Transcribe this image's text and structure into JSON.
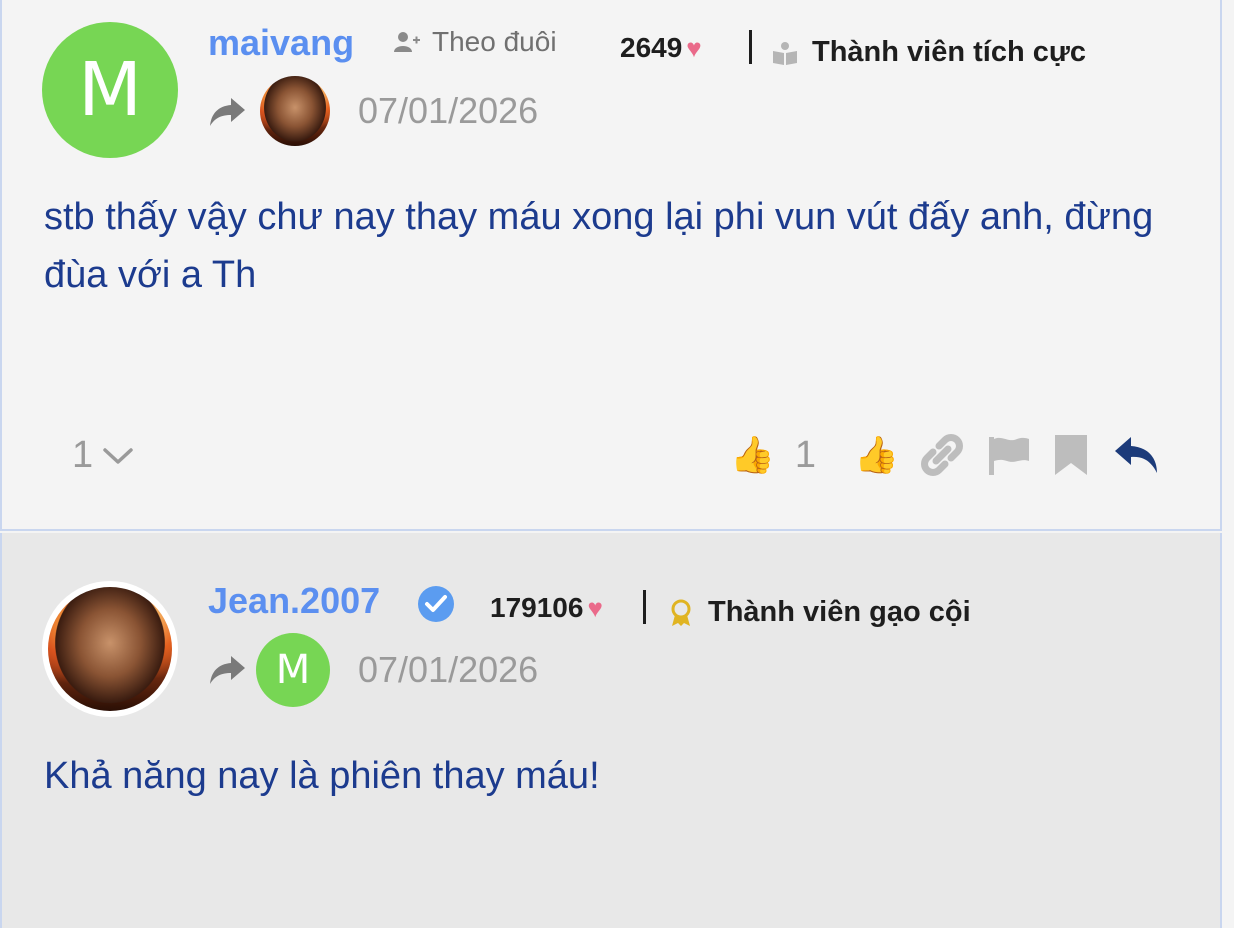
{
  "posts": [
    {
      "username": "maivang",
      "follow_label": "Theo đuôi",
      "points": "2649",
      "rank": "Thành viên tích cực",
      "date": "07/01/2026",
      "avatar_letter": "M",
      "content": "stb thấy vậy chư nay thay máu xong lại phi vun vút đấy anh, đừng đùa với a Th",
      "reply_count": "1",
      "like_count": "1"
    },
    {
      "username": "Jean.2007",
      "points": "179106",
      "rank": "Thành viên gạo cội",
      "date": "07/01/2026",
      "reply_to_letter": "M",
      "content": "Khả năng nay là phiên thay máu!"
    }
  ],
  "colors": {
    "username": "#5b8ff0",
    "content_text": "#1c3b8e",
    "avatar_green": "#77d654",
    "heart": "#ea6a8a",
    "reply_icon": "#1c3b7a"
  }
}
